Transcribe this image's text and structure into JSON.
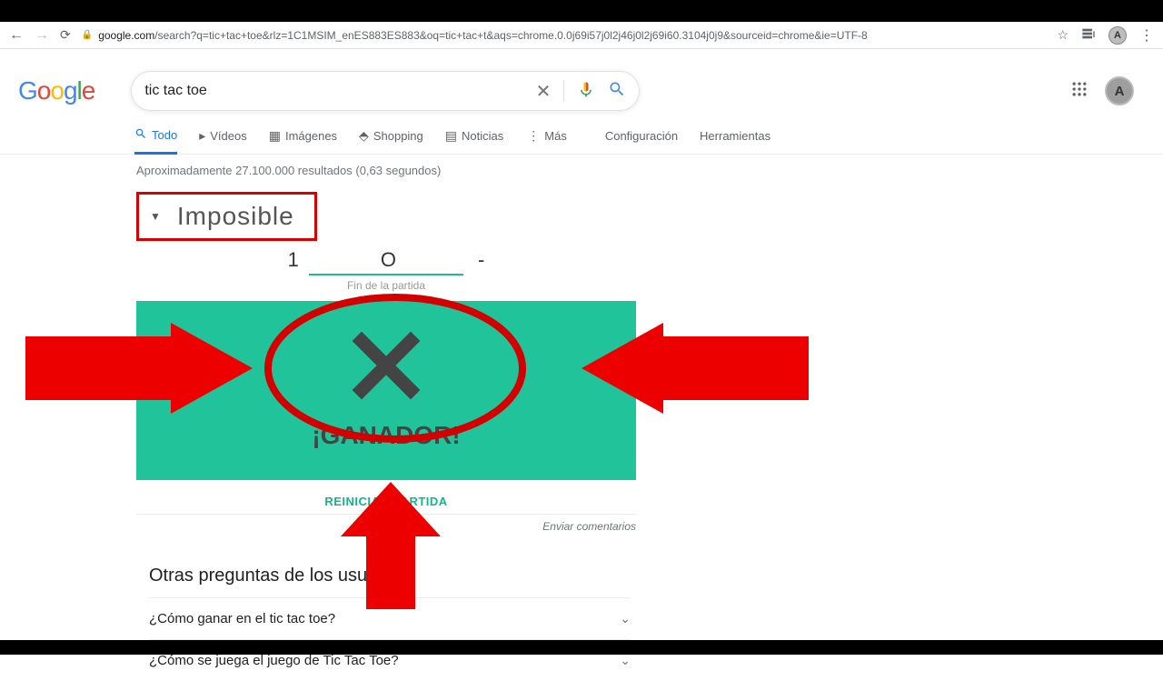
{
  "browser": {
    "url_domain": "google.com",
    "url_path": "/search?q=tic+tac+toe&rlz=1C1MSIM_enES883ES883&oq=tic+tac+t&aqs=chrome.0.0j69i57j0l2j46j0l2j69i60.3104j0j9&sourceid=chrome&ie=UTF-8",
    "avatar_letter": "A"
  },
  "search": {
    "query": "tic tac toe"
  },
  "tabs": {
    "all": "Todo",
    "videos": "Vídeos",
    "images": "Imágenes",
    "shopping": "Shopping",
    "news": "Noticias",
    "more": "Más",
    "settings": "Configuración",
    "tools": "Herramientas"
  },
  "stats": "Aproximadamente 27.100.000 resultados (0,63 segundos)",
  "game": {
    "difficulty": "Imposible",
    "score_x": "1",
    "score_o_label": "O",
    "score_dash": "-",
    "end_label": "Fin de la partida",
    "winner": "¡GANADOR!",
    "restart": "REINICIAR PARTIDA",
    "feedback": "Enviar comentarios"
  },
  "paa": {
    "title": "Otras preguntas de los usuarios",
    "items": [
      "¿Cómo ganar en el tic tac toe?",
      "¿Cómo se juega el juego de Tic Tac Toe?"
    ]
  }
}
